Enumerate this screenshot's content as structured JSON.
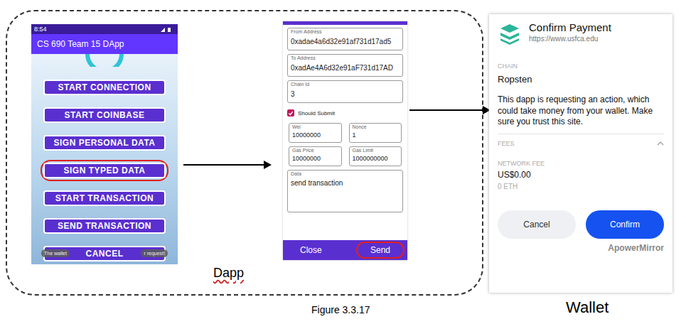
{
  "dapp": {
    "label": "Dapp",
    "phone": {
      "status_bar": {
        "time": "8:54"
      },
      "app_title": "CS 690 Team 15 DApp",
      "buttons": [
        {
          "label": "START CONNECTION",
          "highlighted": false
        },
        {
          "label": "START COINBASE",
          "highlighted": false
        },
        {
          "label": "SIGN PERSONAL DATA",
          "highlighted": false
        },
        {
          "label": "SIGN TYPED DATA",
          "highlighted": true
        },
        {
          "label": "START TRANSACTION",
          "highlighted": false
        },
        {
          "label": "SEND TRANSACTION",
          "highlighted": false
        },
        {
          "label": "CANCEL",
          "highlighted": false
        }
      ],
      "toast": {
        "left": "The wallet",
        "right": "r request!"
      }
    },
    "form": {
      "fields_top": [
        {
          "label": "From Address",
          "value": "0xadae4a6d32e91af731d17ad5"
        },
        {
          "label": "To Address",
          "value": "0xadAe4A6d32e91aF731d17AD"
        },
        {
          "label": "Chain Id",
          "value": "3"
        }
      ],
      "checkbox": {
        "label": "Should Submit",
        "checked": true
      },
      "field_pairs": [
        [
          {
            "label": "Wei",
            "value": "10000000"
          },
          {
            "label": "Nonce",
            "value": "1"
          }
        ],
        [
          {
            "label": "Gas Price",
            "value": "10000000"
          },
          {
            "label": "Gas Limit",
            "value": "1000000000"
          }
        ]
      ],
      "data_field": {
        "label": "Data",
        "value": "send transaction"
      },
      "buttons": [
        {
          "label": "Close",
          "highlighted": false
        },
        {
          "label": "Send",
          "highlighted": true
        }
      ]
    }
  },
  "wallet": {
    "label": "Wallet",
    "title": "Confirm Payment",
    "url": "https://www.usfca.edu",
    "chain_label": "CHAIN",
    "chain": "Ropsten",
    "warning": "This dapp is requesting an action, which could take money from your wallet. Make sure you trust this site.",
    "fees_label": "FEES",
    "network_fee_label": "NETWORK FEE",
    "fee_usd": "US$0.00",
    "fee_eth": "0 ETH",
    "buttons": [
      {
        "label": "Cancel",
        "primary": false
      },
      {
        "label": "Confirm",
        "primary": true
      }
    ],
    "watermark": "ApowerMirror"
  },
  "caption": "Figure 3.3.17"
}
